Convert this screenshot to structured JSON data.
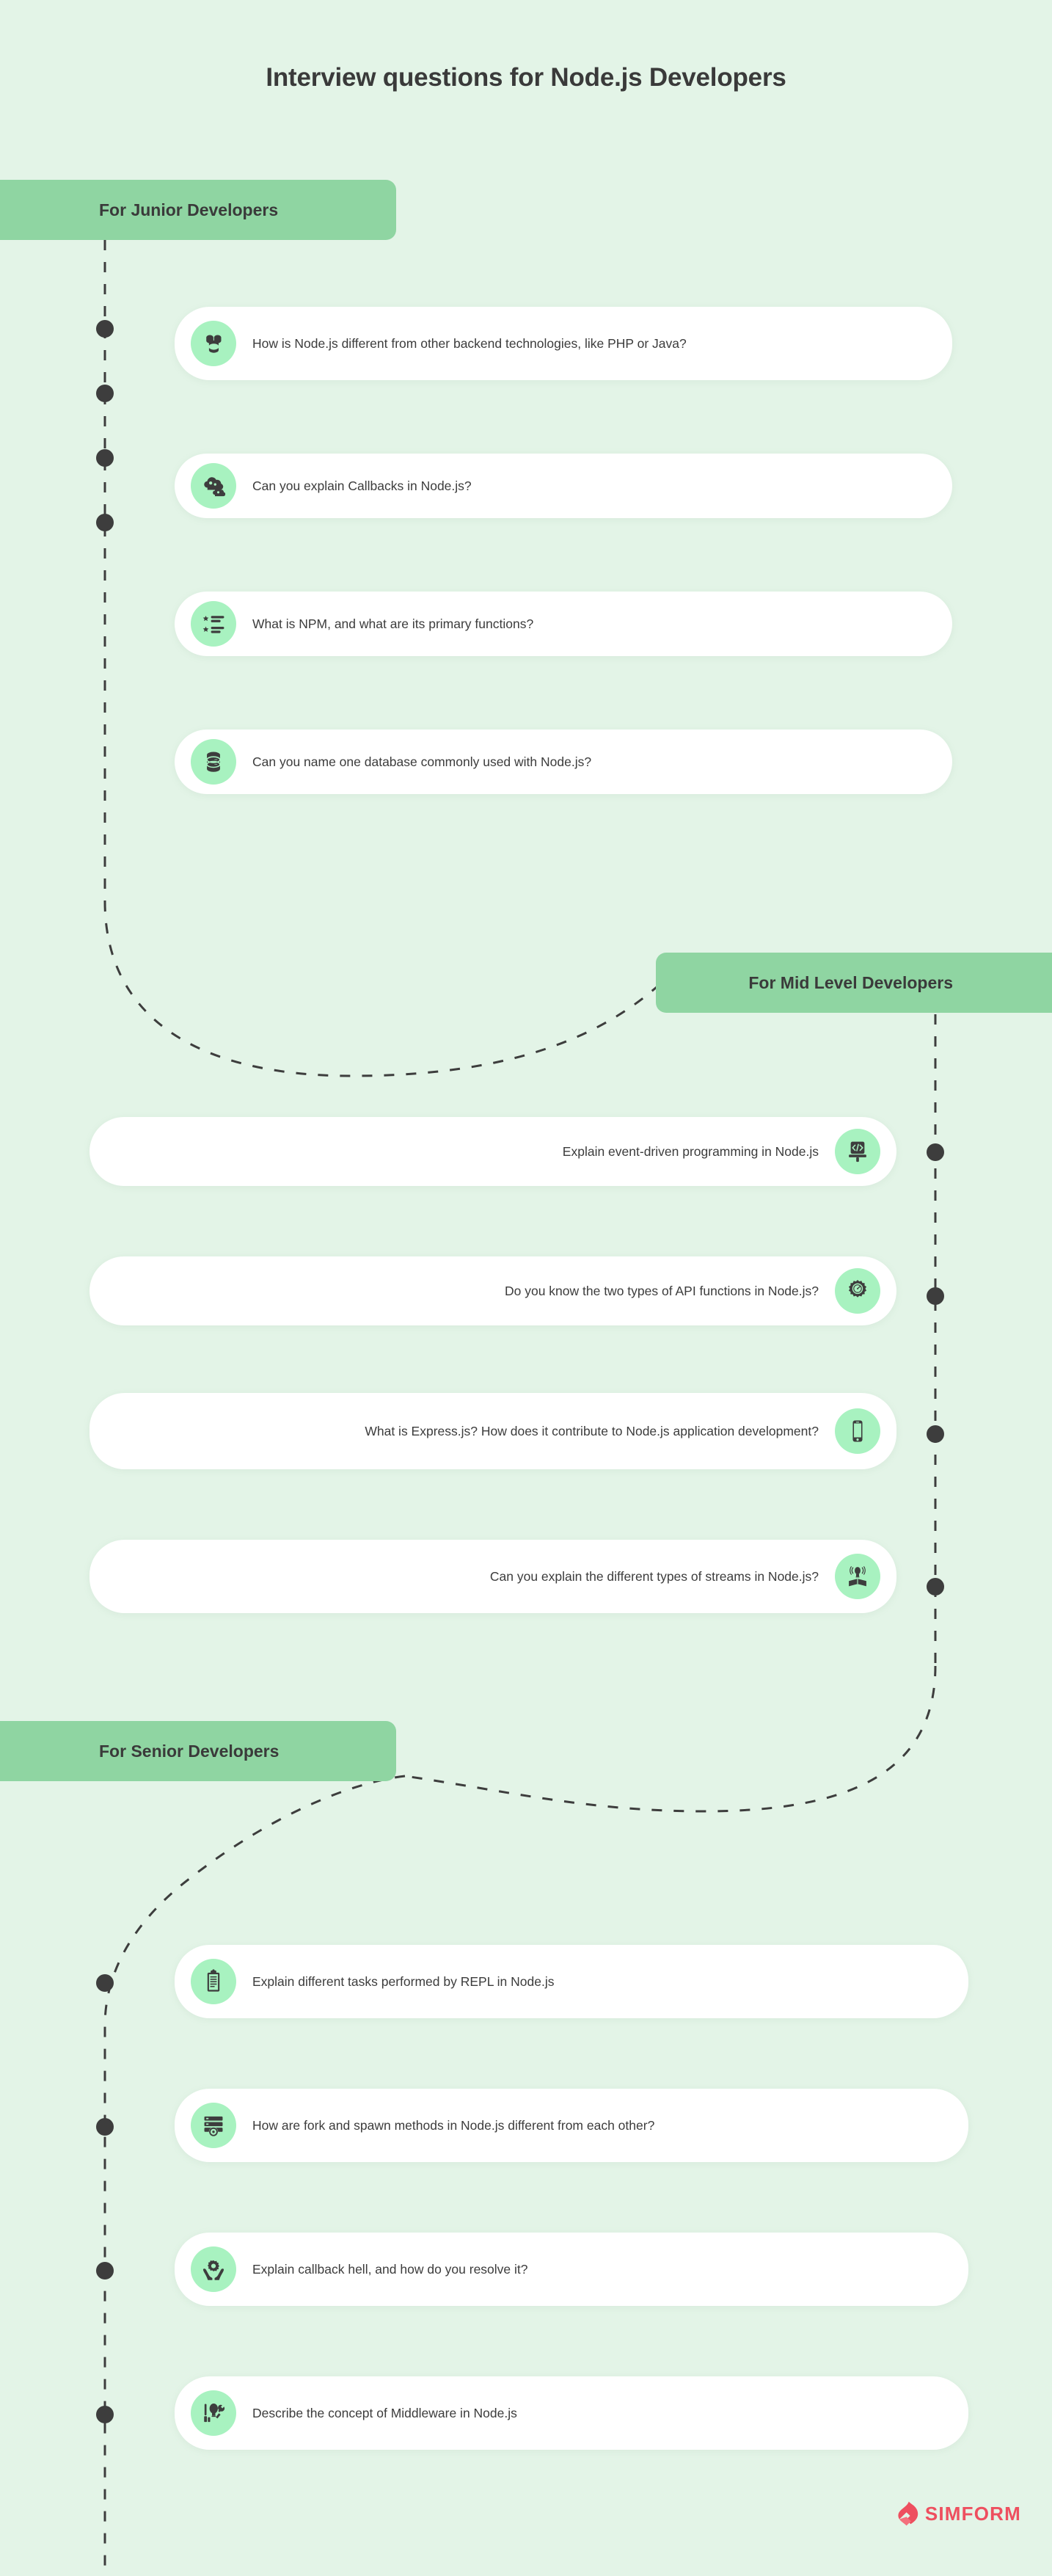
{
  "page": {
    "title": "Interview questions for Node.js Developers",
    "background_color": "#e3f4e7",
    "accent_color": "#8fd5a2",
    "icon_bg_color": "#a8f2c0",
    "brand_color": "#ee4f5f"
  },
  "brand": {
    "name": "SIMFORM",
    "mark": "simform-flame-icon"
  },
  "sections": [
    {
      "id": "junior",
      "header": "For Junior Developers",
      "align": "left",
      "cards": [
        {
          "icon": "database-stack-icon",
          "text": "How is Node.js different from other backend technologies, like PHP or Java?"
        },
        {
          "icon": "cloud-gears-icon",
          "text": "Can you explain Callbacks in Node.js?"
        },
        {
          "icon": "star-list-icon",
          "text": "What is NPM, and what are its primary functions?"
        },
        {
          "icon": "database-icon",
          "text": "Can you name one database commonly used with Node.js?"
        }
      ]
    },
    {
      "id": "mid",
      "header": "For Mid Level Developers",
      "align": "right",
      "cards": [
        {
          "icon": "code-brush-icon",
          "text": "Explain event-driven programming in Node.js"
        },
        {
          "icon": "gear-speed-icon",
          "text": "Do you know the two types of API functions in Node.js?"
        },
        {
          "icon": "mobile-phone-icon",
          "text": "What is Express.js? How does it contribute to Node.js application development?"
        },
        {
          "icon": "idea-book-icon",
          "text": "Can you explain the different types of streams in Node.js?"
        }
      ]
    },
    {
      "id": "senior",
      "header": "For Senior Developers",
      "align": "left",
      "cards": [
        {
          "icon": "clipboard-icon",
          "text": "Explain different tasks performed by REPL in Node.js"
        },
        {
          "icon": "server-search-icon",
          "text": "How are fork and spawn methods in Node.js different from each other?"
        },
        {
          "icon": "hands-gear-icon",
          "text": "Explain callback hell, and how do you resolve it?"
        },
        {
          "icon": "bulb-tools-icon",
          "text": "Describe the concept of Middleware in Node.js"
        }
      ]
    }
  ]
}
